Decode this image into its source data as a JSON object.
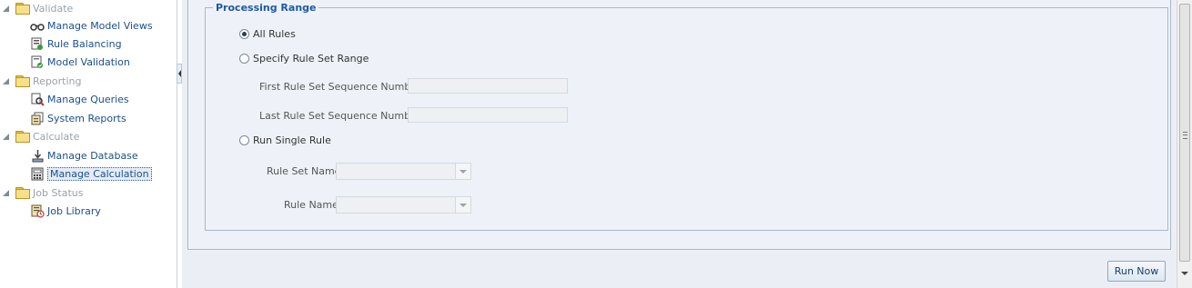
{
  "nav": {
    "groups": [
      {
        "label": "Validate",
        "items": [
          "Manage Model Views",
          "Rule Balancing",
          "Model Validation"
        ]
      },
      {
        "label": "Reporting",
        "items": [
          "Manage Queries",
          "System Reports"
        ]
      },
      {
        "label": "Calculate",
        "items": [
          "Manage Database",
          "Manage Calculation"
        ]
      },
      {
        "label": "Job Status",
        "items": [
          "Job Library"
        ]
      }
    ],
    "selected_item": "Manage Calculation"
  },
  "processing_range": {
    "legend": "Processing Range",
    "all_rules_label": "All Rules",
    "all_rules_selected": true,
    "specify_range_label": "Specify Rule Set Range",
    "first_seq_label": "First Rule Set Sequence Number",
    "first_seq_value": "",
    "last_seq_label": "Last Rule Set Sequence Number",
    "last_seq_value": "",
    "single_rule_label": "Run Single Rule",
    "rule_set_name_label": "Rule Set Name",
    "rule_set_name_value": "",
    "rule_name_label": "Rule Name",
    "rule_name_value": ""
  },
  "actions": {
    "run_now_label": "Run Now"
  }
}
